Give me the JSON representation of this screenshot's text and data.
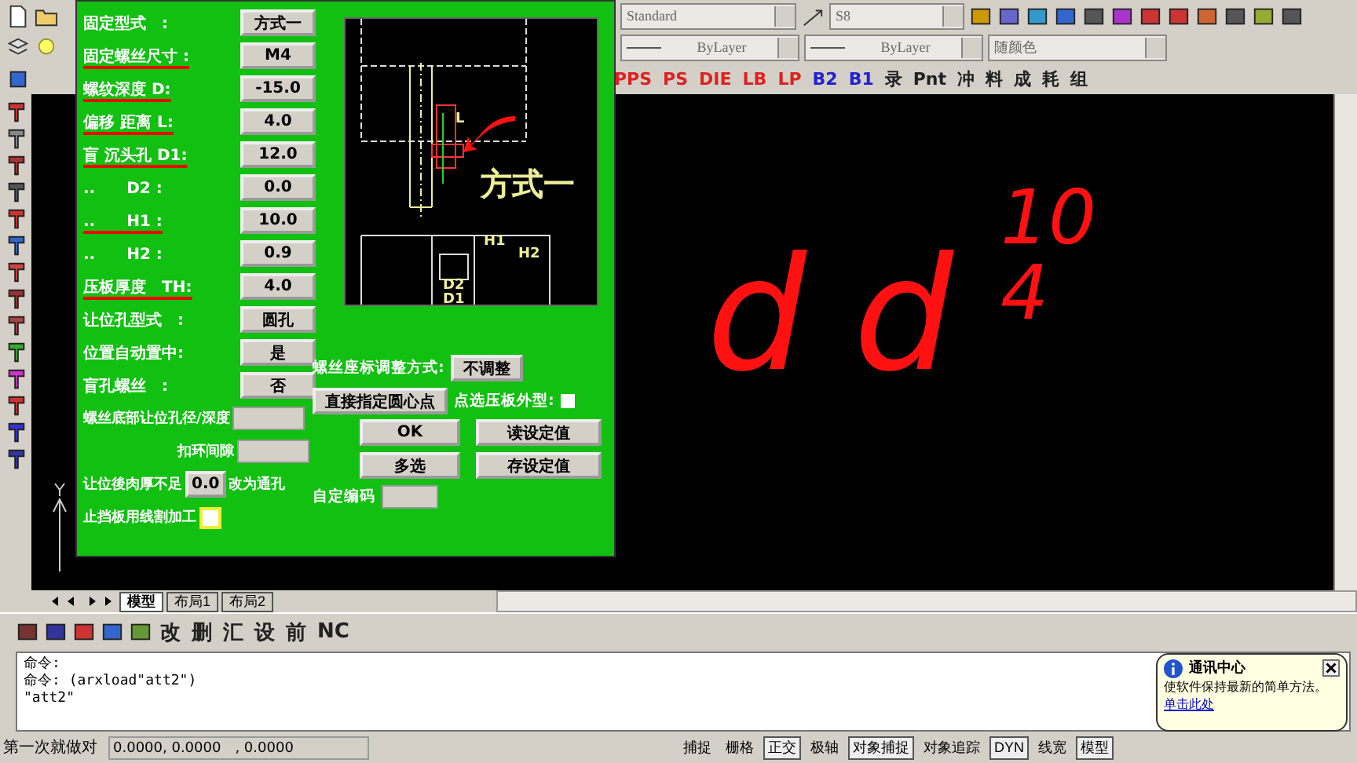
{
  "toolbar": {
    "text_style": "Standard",
    "dim_style": "S8",
    "linetype": "ByLayer",
    "lineweight": "ByLayer",
    "color_mode": "随颜色",
    "custom_buttons": [
      "PPS",
      "PS",
      "DIE",
      "LB",
      "LP",
      "B2",
      "B1",
      "录",
      "Pnt",
      "冲",
      "料",
      "成",
      "耗",
      "组"
    ]
  },
  "dialog": {
    "rows": [
      {
        "label": "固定型式　:",
        "value": "方式一",
        "marked": false
      },
      {
        "label": "固定螺丝尺寸 :",
        "value": "M4",
        "marked": true
      },
      {
        "label": "螺纹深度 D:",
        "value": "-15.0",
        "marked": true
      },
      {
        "label": "偏移 距离 L:",
        "value": "4.0",
        "marked": true
      },
      {
        "label": "盲 沉头孔 D1:",
        "value": "12.0",
        "marked": true
      },
      {
        "label": "..　　D2 :",
        "value": "0.0",
        "marked": false
      },
      {
        "label": "..　　H1 :",
        "value": "10.0",
        "marked": true
      },
      {
        "label": "..　　H2 :",
        "value": "0.9",
        "marked": false
      },
      {
        "label": "压板厚度　TH:",
        "value": "4.0",
        "marked": true
      },
      {
        "label": "让位孔型式　:",
        "value": "圆孔",
        "marked": false
      },
      {
        "label": "位置自动置中:",
        "value": "是",
        "marked": false
      },
      {
        "label": "盲孔螺丝　:",
        "value": "否",
        "marked": false
      }
    ],
    "bottom_hole_label": "螺丝底部让位孔径/深度",
    "ring_gap_label": "扣环间隙",
    "thin_wall_label": "让位後肉厚不足",
    "thin_wall_value": "0.0",
    "thin_wall_suffix": "改为通孔",
    "wire_cut": {
      "label": "止挡板用线割加工",
      "checked": false
    },
    "preview": {
      "mode_text": "方式一",
      "labels": [
        "L",
        "H1",
        "H2",
        "D2",
        "D1"
      ]
    },
    "adjust_label": "螺丝座标调整方式:",
    "adjust_value": "不调整",
    "pick_center_button": "直接指定圆心点",
    "pick_outline": {
      "label": "点选压板外型:",
      "checked": false
    },
    "buttons": [
      "OK",
      "读设定值",
      "多选",
      "存设定值"
    ],
    "code_label": "自定编码"
  },
  "canvas": {
    "handwriting": [
      "d",
      "d",
      "10",
      "4"
    ]
  },
  "layout_tabs": [
    {
      "label": "模型",
      "selected": true
    },
    {
      "label": "布局1",
      "selected": false
    },
    {
      "label": "布局2",
      "selected": false
    }
  ],
  "bottom_toolbar": [
    "改",
    "删",
    "汇",
    "设",
    "前",
    "NC"
  ],
  "command_lines": [
    "命令:",
    "命令: (arxload\"att2\")",
    "\"att2\""
  ],
  "status_bar": {
    "label": "第一次就做对",
    "coords": "0.0000,  0.0000　, 0.0000",
    "toggles": [
      {
        "label": "捕捉",
        "selected": false
      },
      {
        "label": "栅格",
        "selected": false
      },
      {
        "label": "正交",
        "selected": true
      },
      {
        "label": "极轴",
        "selected": false
      },
      {
        "label": "对象捕捉",
        "selected": true
      },
      {
        "label": "对象追踪",
        "selected": false
      },
      {
        "label": "DYN",
        "selected": true
      },
      {
        "label": "线宽",
        "selected": false
      },
      {
        "label": "模型",
        "selected": true
      }
    ]
  },
  "balloon": {
    "title": "通讯中心",
    "text": "使软件保持最新的简单方法。",
    "link": "单击此处"
  }
}
